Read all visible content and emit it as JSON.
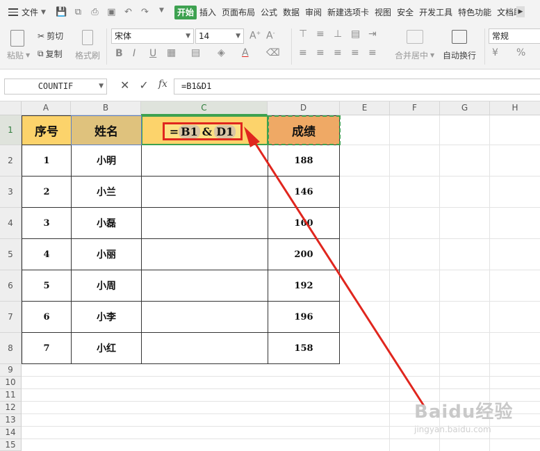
{
  "menubar": {
    "file_label": "文件",
    "tabs": [
      "开始",
      "插入",
      "页面布局",
      "公式",
      "数据",
      "审阅",
      "新建选项卡",
      "视图",
      "安全",
      "开发工具",
      "特色功能",
      "文档助"
    ]
  },
  "ribbon": {
    "paste": "粘贴",
    "cut": "剪切",
    "copy": "复制",
    "format_painter": "格式刷",
    "font_name": "宋体",
    "font_size": "14",
    "merge_center": "合并居中",
    "wrap_text": "自动换行",
    "number_format": "常规"
  },
  "formula_bar": {
    "name_box": "COUNTIF",
    "formula": "=B1&D1"
  },
  "columns": [
    "A",
    "B",
    "C",
    "D",
    "E",
    "F",
    "G",
    "H"
  ],
  "rows": [
    "1",
    "2",
    "3",
    "4",
    "5",
    "6",
    "7",
    "8",
    "9",
    "10",
    "11",
    "12",
    "13",
    "14",
    "15"
  ],
  "table": {
    "headers": [
      "序号",
      "姓名",
      "",
      "成绩"
    ],
    "rows": [
      [
        "1",
        "小明",
        "",
        "188"
      ],
      [
        "2",
        "小兰",
        "",
        "146"
      ],
      [
        "3",
        "小磊",
        "",
        "160"
      ],
      [
        "4",
        "小丽",
        "",
        "200"
      ],
      [
        "5",
        "小周",
        "",
        "192"
      ],
      [
        "6",
        "小李",
        "",
        "196"
      ],
      [
        "7",
        "小红",
        "",
        "158"
      ]
    ]
  },
  "edit_cell": {
    "eq": "=",
    "ref1": "B1",
    "amp": "&",
    "ref2": "D1"
  },
  "watermark": {
    "brand": "Baidu经验",
    "url": "jingyan.baidu.com"
  },
  "colors": {
    "header_a": "#fcd36b",
    "header_b": "#dfc27d",
    "header_c": "#fcd36b",
    "header_d": "#efa965",
    "accent_green": "#3da150",
    "annotation_red": "#e0261e"
  }
}
